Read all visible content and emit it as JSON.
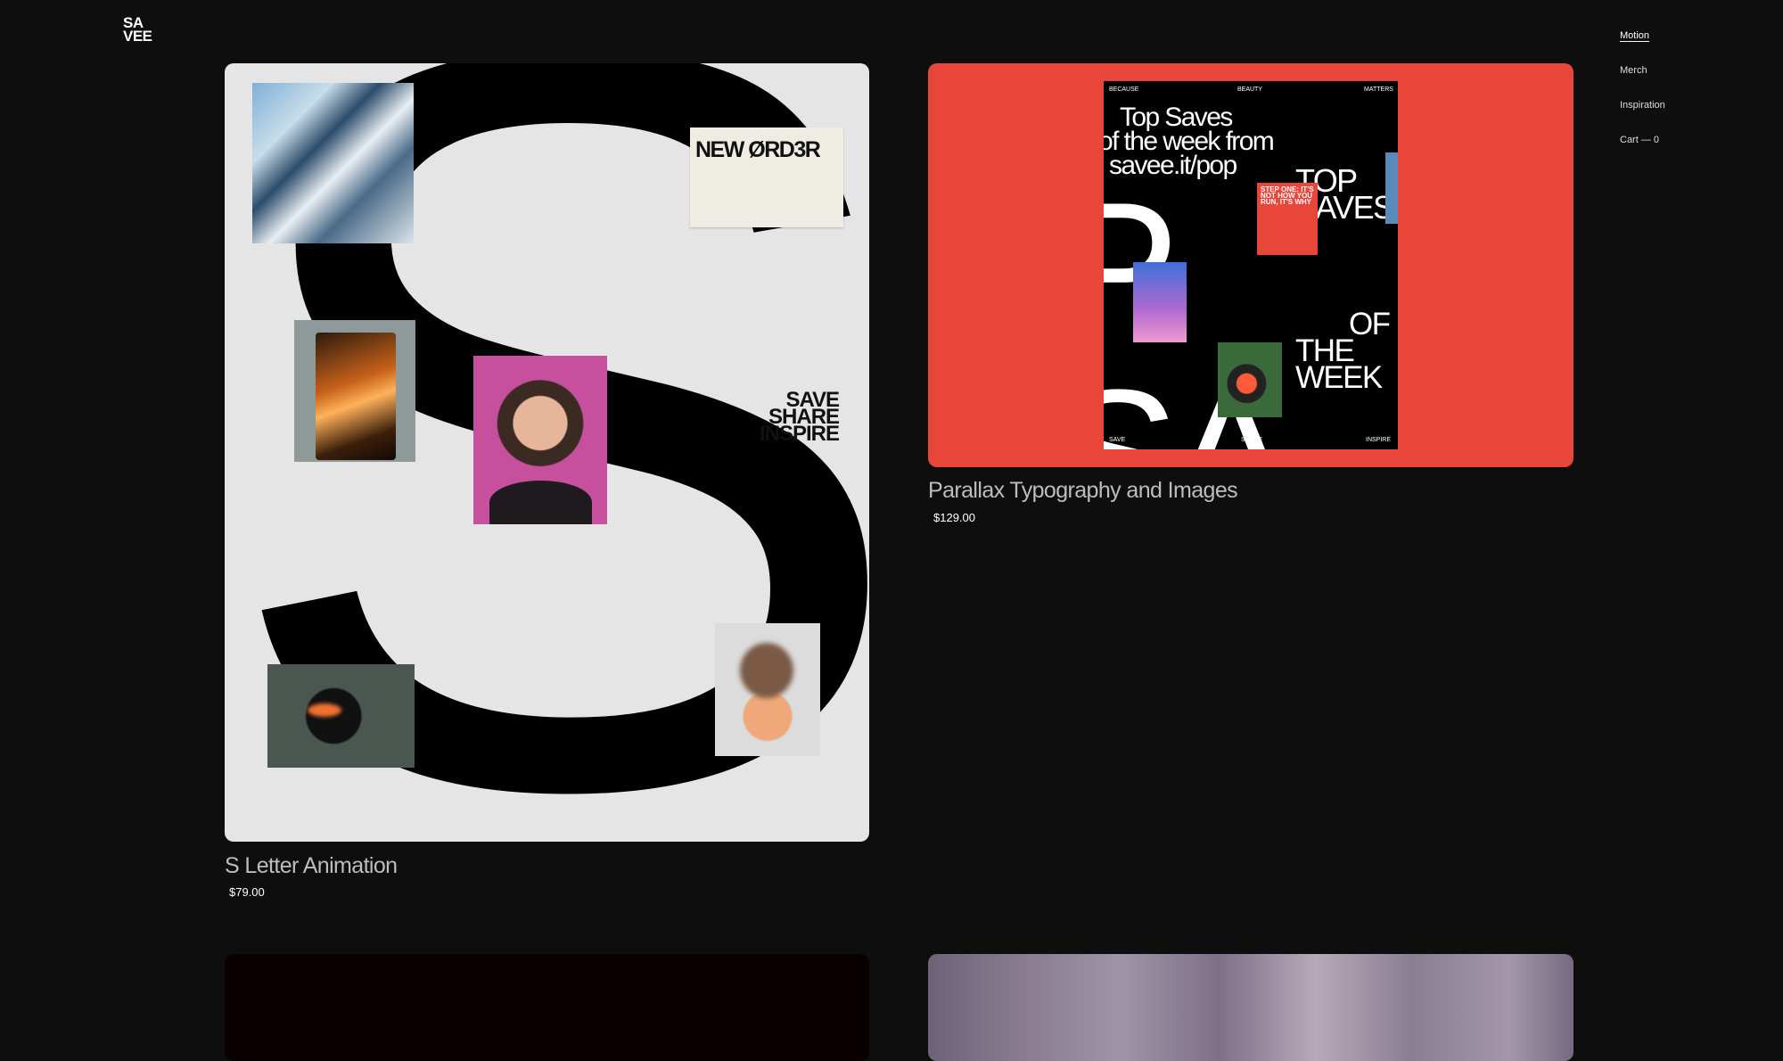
{
  "header": {
    "logo_line1": "SA",
    "logo_line2": "VEE"
  },
  "nav": {
    "items": [
      {
        "label": "Motion",
        "active": true
      },
      {
        "label": "Merch",
        "active": false
      },
      {
        "label": "Inspiration",
        "active": false
      },
      {
        "label": "Cart — 0",
        "active": false
      }
    ]
  },
  "products": [
    {
      "title": "S Letter Animation",
      "price": "$79.00",
      "artwork": {
        "big_letter": "S",
        "card_brand": "NEW ØRD3R",
        "tagline": [
          "SAVE",
          "SHARE",
          "INSPIRE"
        ]
      }
    },
    {
      "title": "Parallax Typography and Images",
      "price": "$129.00",
      "artwork": {
        "top_row": [
          "BECAUSE",
          "BEAUTY",
          "MATTERS"
        ],
        "headline": [
          "Top Saves",
          "of the week from",
          "savee.it/pop"
        ],
        "big_text": "P SA",
        "top_saves": [
          "TOP",
          "SAVES"
        ],
        "step_note": "STEP ONE: IT'S NOT HOW YOU RUN, IT'S WHY",
        "week_text": [
          "OF",
          "THE",
          "WEEK"
        ],
        "bottom_row": [
          "SAVE",
          "SHARE",
          "INSPIRE"
        ]
      }
    }
  ],
  "colors": {
    "background": "#0e0e0e",
    "card1_bg": "#e5e5e5",
    "card2_bg": "#e8463a",
    "title_text": "#bdbdbd"
  }
}
